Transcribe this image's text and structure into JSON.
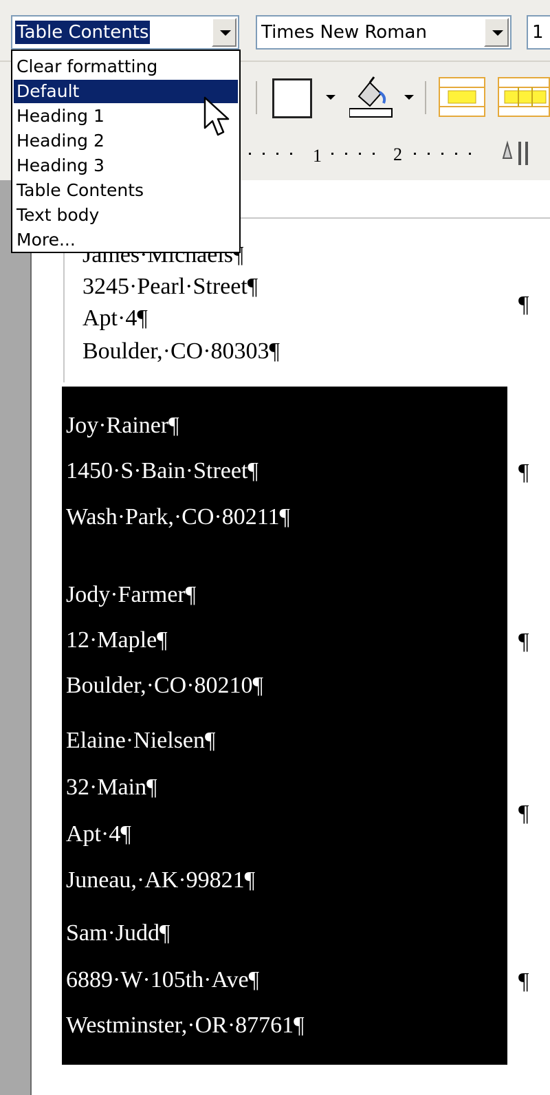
{
  "toolbar": {
    "style_value": "Table Contents",
    "font_value": "Times New Roman",
    "size_value": "1"
  },
  "style_dropdown": {
    "items": [
      {
        "label": "Clear formatting"
      },
      {
        "label": "Default"
      },
      {
        "label": "Heading 1"
      },
      {
        "label": "Heading 2"
      },
      {
        "label": "Heading 3"
      },
      {
        "label": "Table Contents"
      },
      {
        "label": "Text body"
      },
      {
        "label": "More..."
      }
    ],
    "highlighted": "Default"
  },
  "ruler": {
    "marks": [
      "1",
      "2"
    ]
  },
  "document": {
    "addresses": [
      {
        "lines": [
          "James·Michaels¶",
          "3245·Pearl·Street¶",
          "Apt·4¶",
          "Boulder,·CO·80303¶"
        ]
      },
      {
        "lines": [
          "Joy·Rainer¶",
          "1450·S·Bain·Street¶",
          "Wash·Park,·CO·80211¶"
        ]
      },
      {
        "lines": [
          "Jody·Farmer¶",
          "12·Maple¶",
          "Boulder,·CO·80210¶"
        ]
      },
      {
        "lines": [
          "Elaine·Nielsen¶",
          "32·Main¶",
          "Apt·4¶",
          "Juneau,·AK·99821¶"
        ]
      },
      {
        "lines": [
          "Sam·Judd¶",
          "6889·W·105th·Ave¶",
          "Westminster,·OR·87761¶"
        ]
      }
    ],
    "pilcrow": "¶"
  },
  "colors": {
    "selection": "#0a246a",
    "toolbar_bg": "#efeeea",
    "gutter": "#a8a8a8"
  },
  "icons": [
    "borders-icon",
    "paint-bucket-icon",
    "table-row-icon",
    "table-grid-icon",
    "dropdown-arrow-icon",
    "mouse-pointer-icon"
  ]
}
